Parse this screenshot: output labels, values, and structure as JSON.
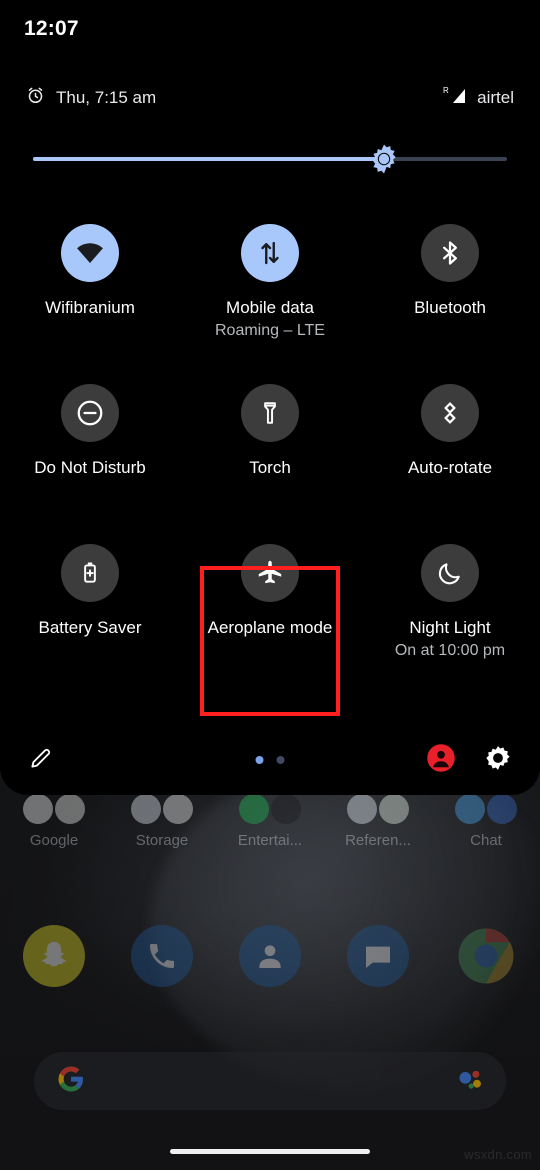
{
  "status_bar": {
    "time": "12:07"
  },
  "qs_header": {
    "alarm_icon": "alarm-clock-icon",
    "date": "Thu, 7:15 am",
    "roaming_indicator": "R",
    "signal_icon": "cellular-signal-icon",
    "carrier": "airtel"
  },
  "brightness": {
    "icon": "brightness-sun-icon",
    "level_percent": 74,
    "fill_color": "#a8c7fa",
    "track_color": "#3b4252"
  },
  "colors": {
    "tile_active": "#a8c7fa",
    "tile_inactive": "#3c3c3c",
    "highlight": "#ff1f1f",
    "panel_background": "#000000",
    "active_icon": "#1a1c20",
    "inactive_icon": "#ffffff"
  },
  "tiles": [
    {
      "id": "wifi",
      "label": "Wifibranium",
      "sub": "",
      "icon": "wifi-icon",
      "state": "on"
    },
    {
      "id": "mobile-data",
      "label": "Mobile data",
      "sub": "Roaming – LTE",
      "icon": "mobile-data-arrows-icon",
      "state": "on"
    },
    {
      "id": "bluetooth",
      "label": "Bluetooth",
      "sub": "",
      "icon": "bluetooth-icon",
      "state": "off"
    },
    {
      "id": "do-not-disturb",
      "label": "Do Not Disturb",
      "sub": "",
      "icon": "do-not-disturb-icon",
      "state": "off"
    },
    {
      "id": "torch",
      "label": "Torch",
      "sub": "",
      "icon": "flashlight-icon",
      "state": "off"
    },
    {
      "id": "auto-rotate",
      "label": "Auto-rotate",
      "sub": "",
      "icon": "auto-rotate-icon",
      "state": "off"
    },
    {
      "id": "battery-saver",
      "label": "Battery Saver",
      "sub": "",
      "icon": "battery-saver-icon",
      "state": "off"
    },
    {
      "id": "aeroplane-mode",
      "label": "Aeroplane mode",
      "sub": "",
      "icon": "airplane-icon",
      "state": "off",
      "highlighted": true
    },
    {
      "id": "night-light",
      "label": "Night Light",
      "sub": "On at 10:00 pm",
      "icon": "crescent-moon-icon",
      "state": "off"
    }
  ],
  "footer": {
    "edit_icon": "pencil-edit-icon",
    "pages": 2,
    "active_page": 1,
    "user_icon": "user-account-icon",
    "user_icon_color": "#e8202a",
    "settings_icon": "gear-settings-icon"
  },
  "home_screen": {
    "folders": [
      {
        "label": "Google"
      },
      {
        "label": "Storage"
      },
      {
        "label": "Entertai..."
      },
      {
        "label": "Referen..."
      },
      {
        "label": "Chat"
      }
    ],
    "dock_apps": [
      {
        "name": "snapchat",
        "color": "#c9c425"
      },
      {
        "name": "phone",
        "color": "#1f4f85"
      },
      {
        "name": "contacts",
        "color": "#1f4f85"
      },
      {
        "name": "messages",
        "color": "#1f4f85"
      },
      {
        "name": "chrome",
        "color": "#3f7d4f"
      }
    ],
    "search_bar": {
      "google_logo": "google-g-icon",
      "assistant_icon": "google-assistant-icon",
      "text": ""
    },
    "nav_pill": "home-gesture-pill"
  },
  "watermark": "wsxdn.com"
}
